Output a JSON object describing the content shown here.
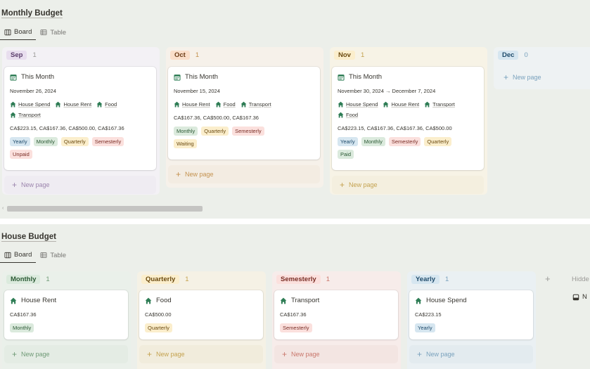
{
  "colors": {
    "sep_bg": "#f3f1f5",
    "sep_pill": "#e8deee",
    "oct_bg": "#f6f1ea",
    "oct_pill": "#fadec9",
    "nov_bg": "#f7f3e6",
    "nov_pill": "#fbeecc",
    "dec_bg": "#eef2f3",
    "dec_pill": "#d6e6f0",
    "green_icon": "#2e7d55"
  },
  "monthly_budget": {
    "title": "Monthly Budget",
    "tabs": [
      {
        "label": "Board",
        "icon": "board-icon"
      },
      {
        "label": "Table",
        "icon": "table-icon"
      }
    ],
    "columns": [
      {
        "name": "Sep",
        "count": "1",
        "new_page": "New page",
        "cards": [
          {
            "title": "This Month",
            "date": "November 26, 2024",
            "relations": [
              "House Spend",
              "House Rent",
              "Food",
              "Transport"
            ],
            "amounts": "CA$223.15, CA$167.36, CA$500.00, CA$167.36",
            "tags": [
              "Yearly",
              "Monthly",
              "Quarterly",
              "Semesterly"
            ],
            "status": "Unpaid"
          }
        ]
      },
      {
        "name": "Oct",
        "count": "1",
        "new_page": "New page",
        "cards": [
          {
            "title": "This Month",
            "date": "November 15, 2024",
            "relations": [
              "House Rent",
              "Food",
              "Transport"
            ],
            "amounts": "CA$167.36, CA$500.00, CA$167.36",
            "tags": [
              "Monthly",
              "Quarterly",
              "Semesterly"
            ],
            "status": "Waiting"
          }
        ]
      },
      {
        "name": "Nov",
        "count": "1",
        "new_page": "New page",
        "cards": [
          {
            "title": "This Month",
            "date": "November 30, 2024 → December 7, 2024",
            "relations": [
              "House Spend",
              "House Rent",
              "Transport",
              "Food"
            ],
            "amounts": "CA$223.15, CA$167.36, CA$167.36, CA$500.00",
            "tags": [
              "Yearly",
              "Monthly",
              "Semesterly",
              "Quarterly"
            ],
            "status": "Paid"
          }
        ]
      },
      {
        "name": "Dec",
        "count": "0",
        "new_page": "New page",
        "cards": []
      }
    ]
  },
  "house_budget": {
    "title": "House Budget",
    "tabs": [
      {
        "label": "Board",
        "icon": "board-icon"
      },
      {
        "label": "Table",
        "icon": "table-icon"
      }
    ],
    "columns": [
      {
        "name": "Monthly",
        "count": "1",
        "new_page": "New page",
        "cards": [
          {
            "title": "House Rent",
            "amount": "CA$167.36",
            "tag": "Monthly"
          }
        ]
      },
      {
        "name": "Quarterly",
        "count": "1",
        "new_page": "New page",
        "cards": [
          {
            "title": "Food",
            "amount": "CA$500.00",
            "tag": "Quarterly"
          }
        ]
      },
      {
        "name": "Semesterly",
        "count": "1",
        "new_page": "New page",
        "cards": [
          {
            "title": "Transport",
            "amount": "CA$167.36",
            "tag": "Semesterly"
          }
        ]
      },
      {
        "name": "Yearly",
        "count": "1",
        "new_page": "New page",
        "cards": [
          {
            "title": "House Spend",
            "amount": "CA$223.15",
            "tag": "Yearly"
          }
        ]
      }
    ],
    "add_group": "+",
    "hidden_label": "Hidde",
    "hidden_item": "N"
  }
}
